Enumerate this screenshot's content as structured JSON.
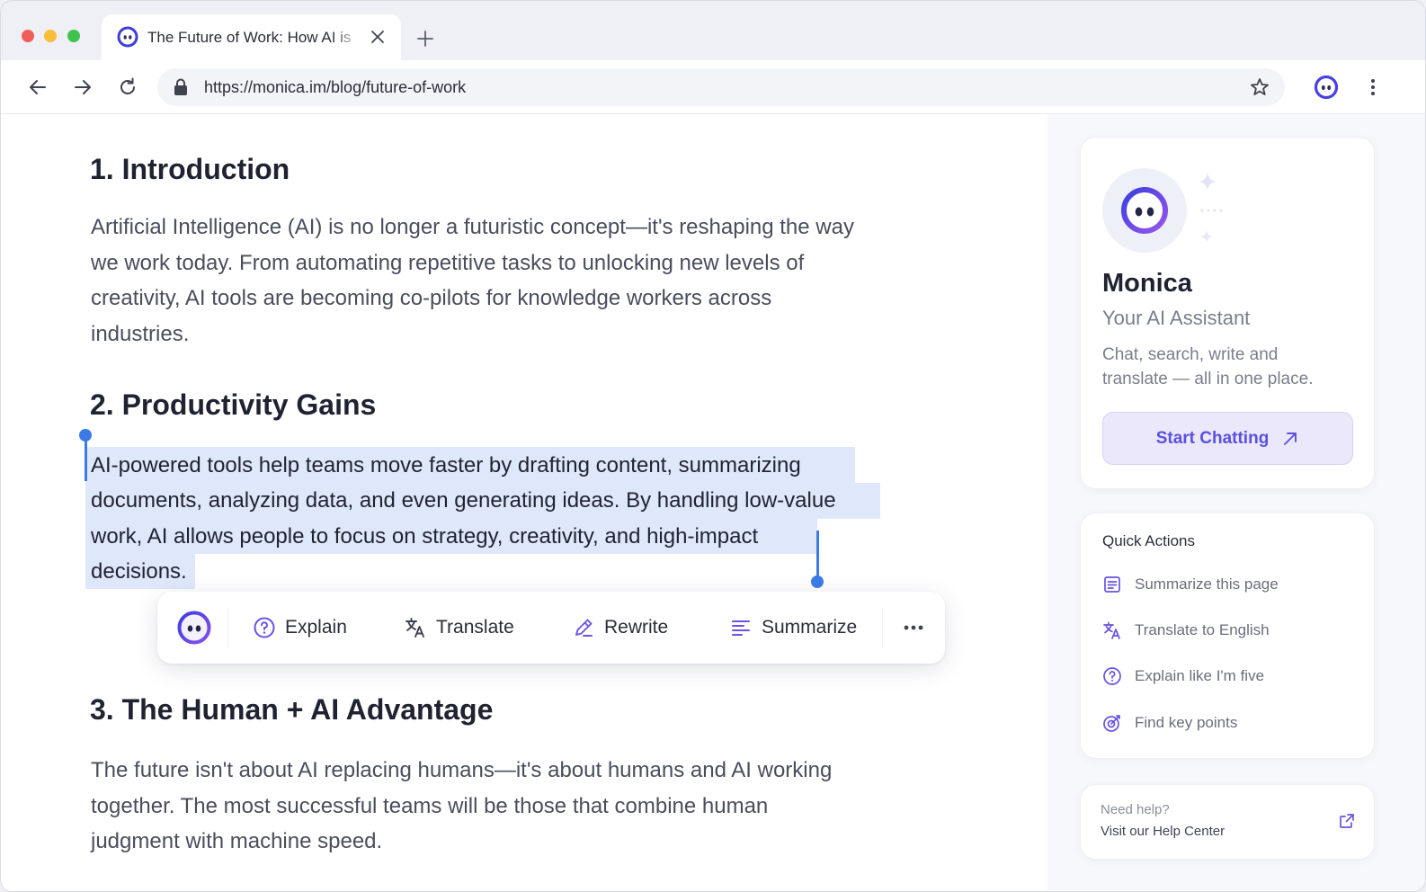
{
  "browser": {
    "tab_title": "The Future of Work: How AI is",
    "url": "https://monica.im/blog/future-of-work"
  },
  "article": {
    "sections": [
      {
        "heading": "1. Introduction",
        "lines": [
          "Artificial Intelligence (AI) is no longer a futuristic concept—it's reshaping the way",
          "we work today. From automating repetitive tasks to unlocking new levels of",
          "creativity, AI tools are becoming co-pilots for knowledge workers across",
          "industries."
        ]
      },
      {
        "heading": "2. Productivity Gains",
        "lines": [
          "AI-powered tools help teams move faster by drafting content, summarizing",
          "documents, analyzing data, and even generating ideas. By handling low-value",
          "work, AI allows people to focus on strategy, creativity, and high-impact",
          "decisions."
        ]
      },
      {
        "heading": "3. The Human + AI Advantage",
        "lines": [
          "The future isn't about AI replacing humans—it's about humans and AI working",
          "together. The most successful teams will be those that combine human",
          "judgment with machine speed."
        ]
      }
    ]
  },
  "action_bar": {
    "explain": "Explain",
    "translate": "Translate",
    "rewrite": "Rewrite",
    "summarize": "Summarize"
  },
  "sidebar": {
    "name": "Monica",
    "subtitle": "Your AI Assistant",
    "description": "Chat, search, write and translate — all in one place.",
    "start_button": "Start Chatting",
    "quick_actions_title": "Quick Actions",
    "quick_actions": [
      {
        "label": "Summarize this page",
        "icon": "summary-icon"
      },
      {
        "label": "Translate to English",
        "icon": "translate-icon"
      },
      {
        "label": "Explain like I'm five",
        "icon": "question-icon"
      },
      {
        "label": "Find key points",
        "icon": "target-icon"
      }
    ],
    "help_line1": "Need help?",
    "help_line2": "Visit our Help Center"
  },
  "colors": {
    "accent": "#5b4fe0",
    "selection": "#dfe8fb",
    "caret": "#3b7be8"
  }
}
